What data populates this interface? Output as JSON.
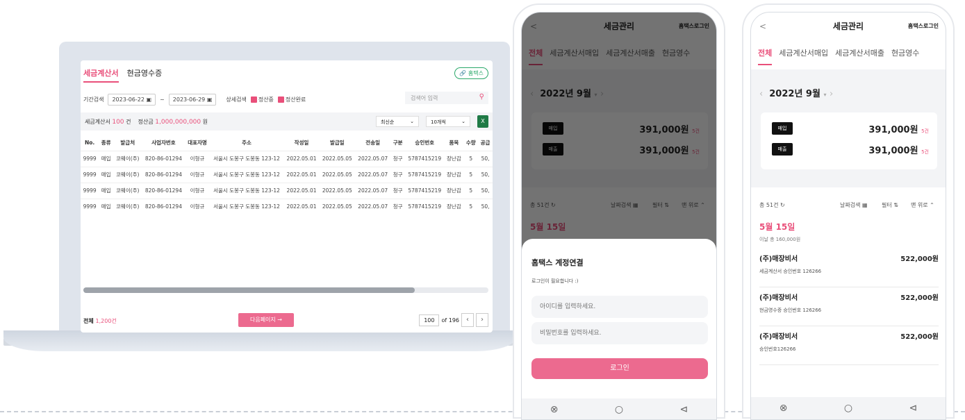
{
  "desktop": {
    "tabs": [
      "세금계산서",
      "현금영수증"
    ],
    "hometax_btn": "홈택스",
    "period_label": "기간검색",
    "date_from": "2023-06-22",
    "date_sep": "~",
    "date_to": "2023-06-29",
    "detail_label": "상세검색",
    "chk1": "정산중",
    "chk2": "정산완료",
    "search_placeholder": "검색어 입력",
    "summary_label": "세금계산서",
    "summary_count": "100",
    "summary_unit": "건",
    "settle_label": "정산금",
    "settle_amount": "1,000,000,000",
    "settle_unit": "원",
    "sort": "최신순",
    "per_page": "10개씩",
    "headers": [
      "No.",
      "종류",
      "발급처",
      "사업자번호",
      "대표자명",
      "주소",
      "작성일",
      "발급일",
      "전송일",
      "구분",
      "승인번호",
      "품목",
      "수량",
      "공급"
    ],
    "rows": [
      [
        "9999",
        "매입",
        "코웨이(주)",
        "820-86-01294",
        "이형규",
        "서울시 도봉구 도봉동 123-12",
        "2022.05.01",
        "2022.05.05",
        "2022.05.07",
        "청구",
        "5787415219",
        "장난감",
        "5",
        "50,"
      ],
      [
        "9999",
        "매입",
        "코웨이(주)",
        "820-86-01294",
        "이형규",
        "서울시 도봉구 도봉동 123-12",
        "2022.05.01",
        "2022.05.05",
        "2022.05.07",
        "청구",
        "5787415219",
        "장난감",
        "5",
        "50,"
      ],
      [
        "9999",
        "매입",
        "코웨이(주)",
        "820-86-01294",
        "이형규",
        "서울시 도봉구 도봉동 123-12",
        "2022.05.01",
        "2022.05.05",
        "2022.05.07",
        "청구",
        "5787415219",
        "장난감",
        "5",
        "50,"
      ],
      [
        "9999",
        "매입",
        "코웨이(주)",
        "820-86-01294",
        "이형규",
        "서울시 도봉구 도봉동 123-12",
        "2022.05.01",
        "2022.05.05",
        "2022.05.07",
        "청구",
        "5787415219",
        "장난감",
        "5",
        "50,"
      ]
    ],
    "total_label": "전체",
    "total_value": "1,200건",
    "next_btn": "다음페이지 →",
    "page_size": "100",
    "page_of": "of 196"
  },
  "phone": {
    "title": "세금관리",
    "back": "<",
    "hometax_login": "홈택스로그인",
    "tabs": [
      "전체",
      "세금계산서매입",
      "세금계산서매출",
      "현금영수"
    ],
    "month": "2022년 9월",
    "buy_label": "매입",
    "buy_amount": "391,000원",
    "buy_count": "5건",
    "sell_label": "매출",
    "sell_amount": "391,000원",
    "sell_count": "5건",
    "total": "총 51건",
    "date_search": "날짜검색",
    "filter": "필터",
    "to_top": "맨 위로",
    "day": "5월 15일",
    "day_sub": "이날 총 160,000원",
    "items": [
      {
        "name": "(주)매장비서",
        "price": "522,000원",
        "sub": "세금계산서  승인번호 126266"
      },
      {
        "name": "(주)매장비서",
        "price": "522,000원",
        "sub": "현금영수증  승인번호 126266"
      },
      {
        "name": "(주)매장비서",
        "price": "522,000원",
        "sub": "승인번호126266"
      }
    ],
    "sheet_title": "홈택스 계정연결",
    "sheet_sub": "로그인이 필요합니다 :)",
    "id_placeholder": "아이디를 입력하세요.",
    "pw_placeholder": "비밀번호를 입력하세요.",
    "login_btn": "로그인"
  },
  "colors": {
    "accent": "#e94f7a",
    "button": "#ec6a8f",
    "excel": "#1f7a46"
  }
}
